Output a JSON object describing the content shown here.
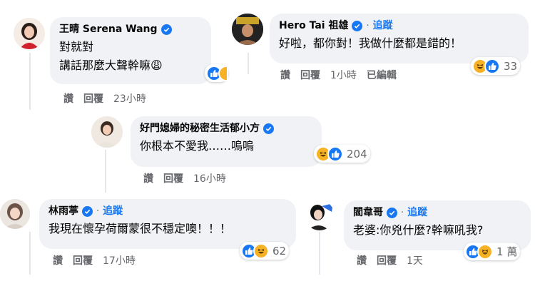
{
  "labels": {
    "like": "讚",
    "reply": "回覆",
    "follow": "追蹤",
    "dot": "·",
    "edited": "已編輯"
  },
  "comments": [
    {
      "name": "王晴 Serena Wang",
      "text1": "對就對",
      "text2": "講話那麼大聲幹嘛",
      "emoji": "😩",
      "time": "23小時"
    },
    {
      "name": "Hero Tai 祖雄",
      "text1": "好啦，都你對！我做什麼都是錯的！",
      "reaction_count": "33",
      "time": "1小時"
    },
    {
      "name": "好門媳婦的秘密生活郁小方",
      "text1": "你根本不愛我……嗚嗚",
      "reaction_count": "204",
      "time": "16小時"
    },
    {
      "name": "林雨葶",
      "text1": "我現在懷孕荷爾蒙很不穩定噢！！！",
      "reaction_count": "62",
      "time": "17小時"
    },
    {
      "name": "閻韋哥",
      "text1": "老婆:你兇什麼?幹嘛吼我?",
      "reaction_count": "1 萬",
      "time": "1天"
    }
  ],
  "colors": {
    "accent": "#1877f2",
    "bubble": "#f0f2f5",
    "muted": "#65676b",
    "haha": "#f7b125"
  }
}
